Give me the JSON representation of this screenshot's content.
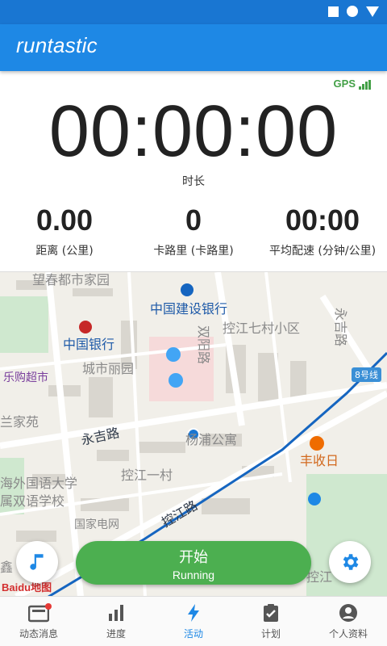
{
  "app": {
    "logo": "runtastic"
  },
  "gps": {
    "label": "GPS"
  },
  "session": {
    "duration": "00:00:00",
    "duration_label": "时长",
    "stats": [
      {
        "value": "0.00",
        "label": "距离 (公里)"
      },
      {
        "value": "0",
        "label": "卡路里 (卡路里)"
      },
      {
        "value": "00:00",
        "label": "平均配速 (分钟/公里)"
      }
    ]
  },
  "map": {
    "pois": [
      {
        "name": "望春都市家园"
      },
      {
        "name": "中国建设银行"
      },
      {
        "name": "中国银行"
      },
      {
        "name": "控江七村小区"
      },
      {
        "name": "永吉路"
      },
      {
        "name": "双阳路"
      },
      {
        "name": "城市丽园"
      },
      {
        "name": "乐购超市"
      },
      {
        "name": "8号线"
      },
      {
        "name": "兰家苑"
      },
      {
        "name": "永吉路"
      },
      {
        "name": "杨浦公寓"
      },
      {
        "name": "丰收日"
      },
      {
        "name": "海外国语大学"
      },
      {
        "name": "属双语学校"
      },
      {
        "name": "控江一村"
      },
      {
        "name": "国家电网"
      },
      {
        "name": "控江路"
      },
      {
        "name": "鑫"
      },
      {
        "name": "控江"
      }
    ],
    "attribution": "Baidu地图"
  },
  "controls": {
    "start_title": "开始",
    "start_subtitle": "Running"
  },
  "nav": [
    {
      "label": "动态消息",
      "icon": "newsfeed-icon"
    },
    {
      "label": "进度",
      "icon": "progress-chart-icon"
    },
    {
      "label": "活动",
      "icon": "activity-bolt-icon"
    },
    {
      "label": "计划",
      "icon": "plan-clipboard-icon"
    },
    {
      "label": "个人资料",
      "icon": "profile-icon"
    }
  ],
  "colors": {
    "primary": "#1e88e5",
    "accent_green": "#4caf50",
    "gps_green": "#43a047"
  }
}
